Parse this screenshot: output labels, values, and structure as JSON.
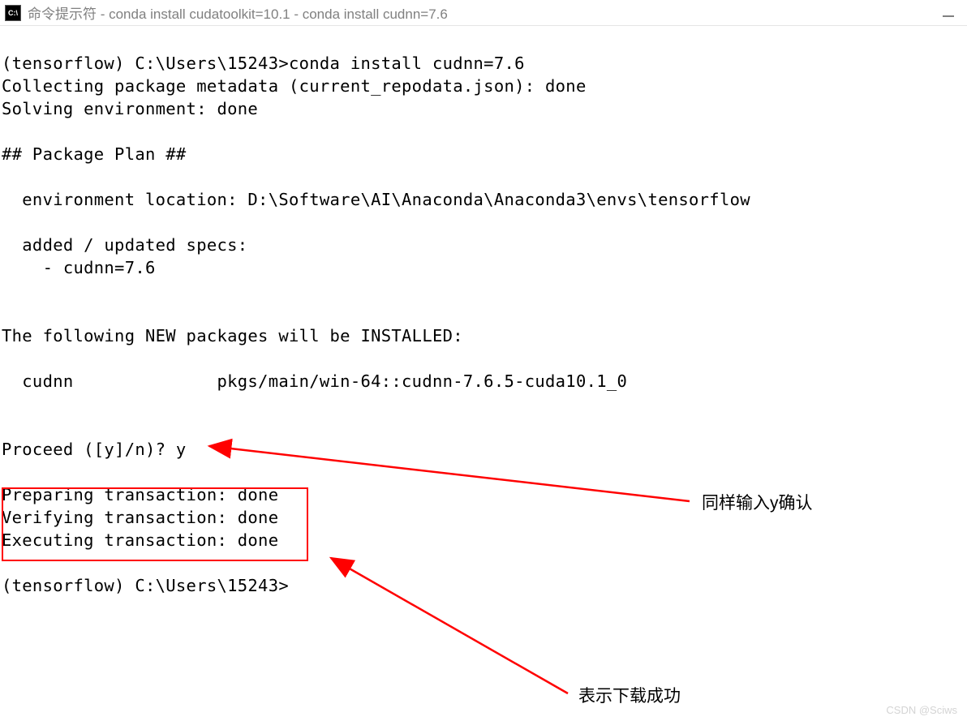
{
  "titlebar": {
    "icon_text": "C:\\",
    "title": "命令提示符 - conda  install cudatoolkit=10.1 - conda  install cudnn=7.6"
  },
  "terminal": {
    "line01": "(tensorflow) C:\\Users\\15243>conda install cudnn=7.6",
    "line02": "Collecting package metadata (current_repodata.json): done",
    "line03": "Solving environment: done",
    "line04": "",
    "line05": "## Package Plan ##",
    "line06": "",
    "line07": "  environment location: D:\\Software\\AI\\Anaconda\\Anaconda3\\envs\\tensorflow",
    "line08": "",
    "line09": "  added / updated specs:",
    "line10": "    - cudnn=7.6",
    "line11": "",
    "line12": "",
    "line13": "The following NEW packages will be INSTALLED:",
    "line14": "",
    "line15": "  cudnn              pkgs/main/win-64::cudnn-7.6.5-cuda10.1_0",
    "line16": "",
    "line17": "",
    "line18": "Proceed ([y]/n)? y",
    "line19": "",
    "line20": "Preparing transaction: done",
    "line21": "Verifying transaction: done",
    "line22": "Executing transaction: done",
    "line23": "",
    "line24": "(tensorflow) C:\\Users\\15243>"
  },
  "annotations": {
    "label1": "同样输入y确认",
    "label2": "表示下载成功"
  },
  "colors": {
    "annotation_red": "#ff0000"
  },
  "watermark": "CSDN @Sciws"
}
